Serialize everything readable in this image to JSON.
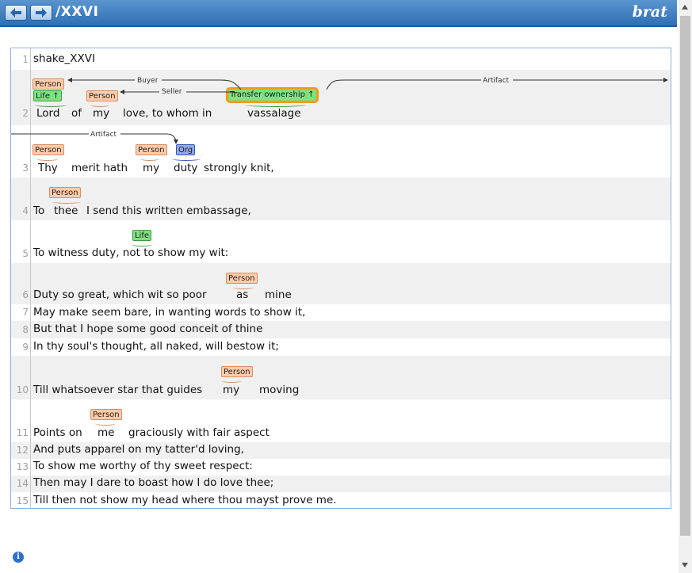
{
  "header": {
    "path": "/XXVI",
    "brand": "brat",
    "back_icon": "arrow-left-icon",
    "forward_icon": "arrow-right-icon"
  },
  "document": {
    "lines": [
      {
        "n": "1",
        "text": "shake_XXVI"
      },
      {
        "n": "2",
        "text": ""
      },
      {
        "n": "3",
        "text": ""
      },
      {
        "n": "4",
        "text": ""
      },
      {
        "n": "5",
        "text": "To witness duty, not to show my wit:"
      },
      {
        "n": "6",
        "text": ""
      },
      {
        "n": "7",
        "text": "May make seem bare, in wanting words to show it,"
      },
      {
        "n": "8",
        "text": "But that I hope some good conceit of thine"
      },
      {
        "n": "9",
        "text": "In thy soul's thought, all naked, will bestow it;"
      },
      {
        "n": "10",
        "text": ""
      },
      {
        "n": "11",
        "text": ""
      },
      {
        "n": "12",
        "text": "And puts apparel on my tatter'd loving,"
      },
      {
        "n": "13",
        "text": "To show me worthy of thy sweet respect:"
      },
      {
        "n": "14",
        "text": "Then may I dare to boast how I do love thee;"
      },
      {
        "n": "15",
        "text": "Till then not show my head where thou mayst prove me."
      }
    ],
    "line2": {
      "lord": "Lord",
      "of": "of",
      "my": "my",
      "rest": "love, to whom in",
      "vassalage": "vassalage"
    },
    "line3": {
      "thy": "Thy",
      "mid": "merit hath",
      "my": "my",
      "duty": "duty",
      "rest": "strongly knit,"
    },
    "line4": {
      "to": "To",
      "thee": "thee",
      "rest": "I send this written embassage,"
    },
    "line6": {
      "pre": "Duty so great, which wit so poor",
      "as": "as",
      "mine": "mine"
    },
    "line10": {
      "pre": "Till whatsoever star that guides",
      "my": "my",
      "moving": "moving"
    },
    "line11": {
      "pre": "Points on",
      "me": "me",
      "rest": "graciously with fair aspect"
    }
  },
  "labels": {
    "person": "Person",
    "life_up": "Life ↑",
    "life": "Life",
    "org": "Org",
    "transfer": "Transfer ownership ↑"
  },
  "arcs": {
    "buyer": "Buyer",
    "seller": "Seller",
    "artifact": "Artifact"
  },
  "colors": {
    "header": "#2f6fb4",
    "person": "#ffccaa",
    "life": "#7fe27f",
    "org": "#8fa8e8",
    "transfer_border": "#f39b1c"
  },
  "info_icon": "info-icon"
}
